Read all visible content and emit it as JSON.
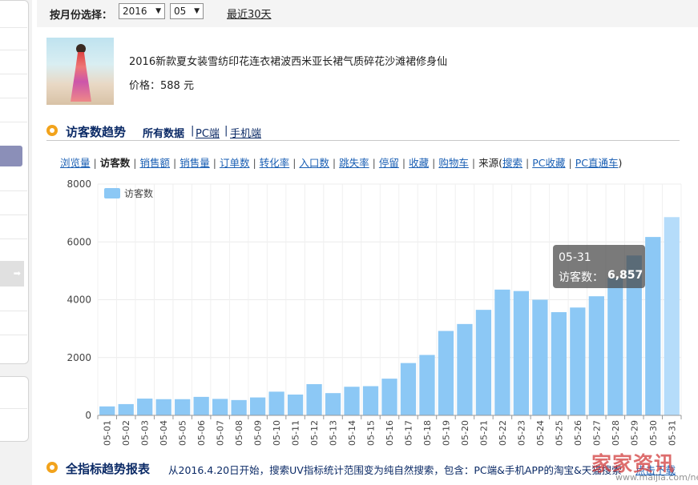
{
  "filter": {
    "month_label": "按月份选择：",
    "year": "2016",
    "month": "05",
    "recent_link": "最近30天"
  },
  "product": {
    "title": "2016新款夏女装雪纺印花连衣裙波西米亚长裙气质碎花沙滩裙修身仙",
    "price_label": "价格：",
    "price_value": "588 元"
  },
  "visitor_section": {
    "title": "访客数趋势",
    "scope_all": "所有数据",
    "scope_pc": "PC端",
    "scope_mobile": "手机端"
  },
  "metrics": {
    "items": [
      "浏览量",
      "访客数",
      "销售额",
      "销售量",
      "订单数",
      "转化率",
      "入口数",
      "跳失率",
      "停留",
      "收藏",
      "购物车"
    ],
    "active": "访客数",
    "source_label": "来源(",
    "sources": [
      "搜索",
      "PC收藏",
      "PC直通车"
    ],
    "source_close": ")"
  },
  "chart_data": {
    "type": "bar",
    "series": [
      {
        "name": "访客数",
        "values": [
          310,
          390,
          580,
          560,
          560,
          640,
          570,
          530,
          620,
          820,
          720,
          1080,
          770,
          990,
          1010,
          1270,
          1810,
          2090,
          2920,
          3160,
          3650,
          4350,
          4300,
          4000,
          3570,
          3730,
          4120,
          4750,
          5530,
          6170,
          6857
        ]
      }
    ],
    "categories": [
      "05-01",
      "05-02",
      "05-03",
      "05-04",
      "05-05",
      "05-06",
      "05-07",
      "05-08",
      "05-09",
      "05-10",
      "05-11",
      "05-12",
      "05-13",
      "05-14",
      "05-15",
      "05-16",
      "05-17",
      "05-18",
      "05-19",
      "05-20",
      "05-21",
      "05-22",
      "05-23",
      "05-24",
      "05-25",
      "05-26",
      "05-27",
      "05-28",
      "05-29",
      "05-30",
      "05-31"
    ],
    "ylim": [
      0,
      8000
    ],
    "yticks": [
      0,
      2000,
      4000,
      6000,
      8000
    ],
    "grid": true,
    "legend": "top-left",
    "color": "#8cc8f5",
    "highlight_color": "#b5dcfa",
    "highlight_index": 30
  },
  "tooltip": {
    "date": "05-31",
    "label": "访客数：",
    "value": "6,857"
  },
  "full_section": {
    "title": "全指标趋势报表",
    "note": "从2016.4.20日开始，搜索UV指标统计范围变为纯自然搜索，包含：PC端&手机APP的淘宝&天猫搜索",
    "download": "点击下载"
  },
  "watermark": {
    "text": "家家资讯",
    "url": "www.maijia.com/news"
  }
}
